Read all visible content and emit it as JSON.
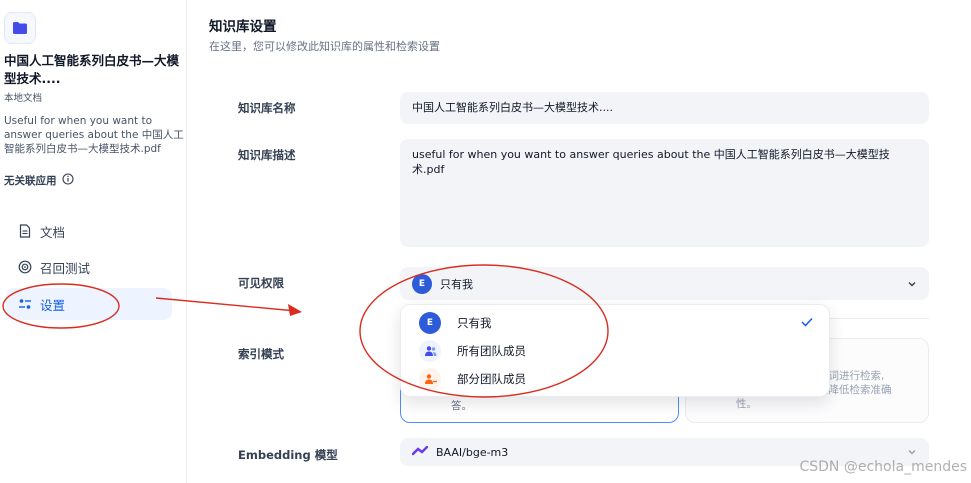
{
  "sidebar": {
    "kb_title": "中国人工智能系列白皮书—大模型技术....",
    "kb_type": "本地文档",
    "kb_description": "Useful for when you want to answer queries about the 中国人工智能系列白皮书—大模型技术.pdf",
    "no_app_label": "无关联应用",
    "nav": [
      {
        "label": "文档",
        "icon": "document-icon"
      },
      {
        "label": "召回测试",
        "icon": "target-icon"
      },
      {
        "label": "设置",
        "icon": "settings-sliders-icon"
      }
    ],
    "active_nav": "设置"
  },
  "main": {
    "title": "知识库设置",
    "subtitle": "在这里，您可以修改此知识库的属性和检索设置",
    "fields": {
      "name_label": "知识库名称",
      "name_value": "中国人工智能系列白皮书—大模型技术....",
      "desc_label": "知识库描述",
      "desc_value": "useful for when you want to answer queries about the 中国人工智能系列白皮书—大模型技术.pdf",
      "permission_label": "可见权限",
      "permission_value": "只有我",
      "permission_avatar": "E",
      "index_label": "索引模式",
      "embedding_label": "Embedding 模型",
      "embedding_value": "BAAI/bge-m3"
    },
    "index_cards": {
      "left_text_tail": "答。",
      "right_text_line1": "键词进行检索,",
      "right_text_line2": "险降低检索准确",
      "right_text_line3": "性。"
    },
    "permission_dropdown": {
      "options": [
        {
          "label": "只有我",
          "avatar": "E",
          "selected": true
        },
        {
          "label": "所有团队成员",
          "selected": false
        },
        {
          "label": "部分团队成员",
          "selected": false
        }
      ]
    }
  },
  "watermark": "CSDN @echola_mendes",
  "colors": {
    "accent": "#155eef",
    "annotation_red": "#d92d20",
    "active_nav_bg": "#eef4ff"
  }
}
